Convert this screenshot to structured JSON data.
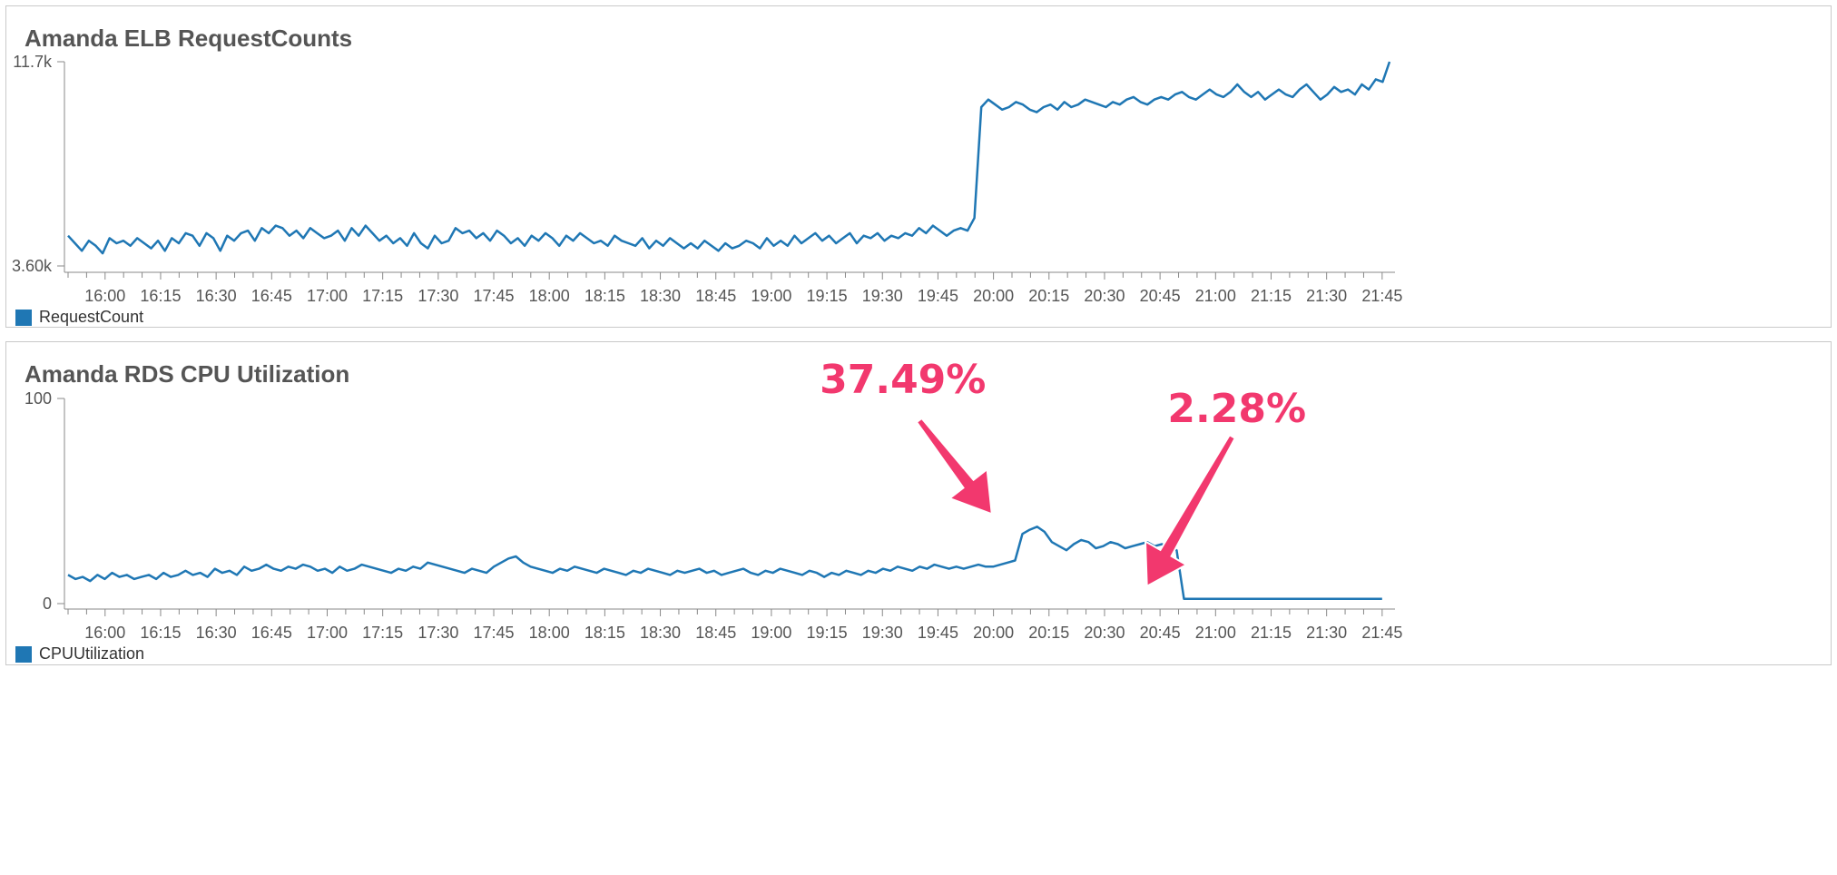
{
  "colors": {
    "series": "#1f77b4",
    "annotation": "#f2386e",
    "axis": "#888888"
  },
  "chart_data": [
    {
      "type": "line",
      "title": "Amanda ELB RequestCounts",
      "ytick_labels": [
        "3.60k",
        "11.7k"
      ],
      "ylim": [
        3600,
        11700
      ],
      "xticks": [
        "16:00",
        "16:15",
        "16:30",
        "16:45",
        "17:00",
        "17:15",
        "17:30",
        "17:45",
        "18:00",
        "18:15",
        "18:30",
        "18:45",
        "19:00",
        "19:15",
        "19:30",
        "19:45",
        "20:00",
        "20:15",
        "20:30",
        "20:45",
        "21:00",
        "21:15",
        "21:30",
        "21:45"
      ],
      "x_range": [
        "15:50",
        "21:47"
      ],
      "legend": "bottom-left",
      "grid": false,
      "series": [
        {
          "name": "RequestCount",
          "x_start": "15:50",
          "x_end": "21:47",
          "values": [
            4800,
            4500,
            4200,
            4600,
            4400,
            4100,
            4700,
            4500,
            4600,
            4400,
            4700,
            4500,
            4300,
            4600,
            4200,
            4700,
            4500,
            4900,
            4800,
            4400,
            4900,
            4700,
            4200,
            4800,
            4600,
            4900,
            5000,
            4600,
            5100,
            4900,
            5200,
            5100,
            4800,
            5000,
            4700,
            5100,
            4900,
            4700,
            4800,
            5000,
            4600,
            5100,
            4800,
            5200,
            4900,
            4600,
            4800,
            4500,
            4700,
            4400,
            4900,
            4500,
            4300,
            4800,
            4500,
            4600,
            5100,
            4900,
            5000,
            4700,
            4900,
            4600,
            5000,
            4800,
            4500,
            4700,
            4400,
            4800,
            4600,
            4900,
            4700,
            4400,
            4800,
            4600,
            4900,
            4700,
            4500,
            4600,
            4400,
            4800,
            4600,
            4500,
            4400,
            4700,
            4300,
            4600,
            4400,
            4700,
            4500,
            4300,
            4500,
            4300,
            4600,
            4400,
            4200,
            4500,
            4300,
            4400,
            4600,
            4500,
            4300,
            4700,
            4400,
            4600,
            4400,
            4800,
            4500,
            4700,
            4900,
            4600,
            4800,
            4500,
            4700,
            4900,
            4500,
            4800,
            4700,
            4900,
            4600,
            4800,
            4700,
            4900,
            4800,
            5100,
            4900,
            5200,
            5000,
            4800,
            5000,
            5100,
            5000,
            5500,
            9900,
            10200,
            10000,
            9800,
            9900,
            10100,
            10000,
            9800,
            9700,
            9900,
            10000,
            9800,
            10100,
            9900,
            10000,
            10200,
            10100,
            10000,
            9900,
            10100,
            10000,
            10200,
            10300,
            10100,
            10000,
            10200,
            10300,
            10200,
            10400,
            10500,
            10300,
            10200,
            10400,
            10600,
            10400,
            10300,
            10500,
            10800,
            10500,
            10300,
            10500,
            10200,
            10400,
            10600,
            10400,
            10300,
            10600,
            10800,
            10500,
            10200,
            10400,
            10700,
            10500,
            10600,
            10400,
            10800,
            10600,
            11000,
            10900,
            11700
          ],
          "annotations": []
        }
      ]
    },
    {
      "type": "line",
      "title": "Amanda RDS CPU Utilization",
      "ytick_labels": [
        "0",
        "100"
      ],
      "ylim": [
        0,
        100
      ],
      "xticks": [
        "16:00",
        "16:15",
        "16:30",
        "16:45",
        "17:00",
        "17:15",
        "17:30",
        "17:45",
        "18:00",
        "18:15",
        "18:30",
        "18:45",
        "19:00",
        "19:15",
        "19:30",
        "19:45",
        "20:00",
        "20:15",
        "20:30",
        "20:45",
        "21:00",
        "21:15",
        "21:30",
        "21:45"
      ],
      "x_range": [
        "15:50",
        "21:47"
      ],
      "legend": "bottom-left",
      "grid": false,
      "series": [
        {
          "name": "CPUUtilization",
          "x_start": "15:50",
          "x_end": "21:45",
          "values": [
            14,
            12,
            13,
            11,
            14,
            12,
            15,
            13,
            14,
            12,
            13,
            14,
            12,
            15,
            13,
            14,
            16,
            14,
            15,
            13,
            17,
            15,
            16,
            14,
            18,
            16,
            17,
            19,
            17,
            16,
            18,
            17,
            19,
            18,
            16,
            17,
            15,
            18,
            16,
            17,
            19,
            18,
            17,
            16,
            15,
            17,
            16,
            18,
            17,
            20,
            19,
            18,
            17,
            16,
            15,
            17,
            16,
            15,
            18,
            20,
            22,
            23,
            20,
            18,
            17,
            16,
            15,
            17,
            16,
            18,
            17,
            16,
            15,
            17,
            16,
            15,
            14,
            16,
            15,
            17,
            16,
            15,
            14,
            16,
            15,
            16,
            17,
            15,
            16,
            14,
            15,
            16,
            17,
            15,
            14,
            16,
            15,
            17,
            16,
            15,
            14,
            16,
            15,
            13,
            15,
            14,
            16,
            15,
            14,
            16,
            15,
            17,
            16,
            18,
            17,
            16,
            18,
            17,
            19,
            18,
            17,
            18,
            17,
            18,
            19,
            18,
            18,
            19,
            20,
            21,
            34,
            36,
            37.49,
            35,
            30,
            28,
            26,
            29,
            31,
            30,
            27,
            28,
            30,
            29,
            27,
            28,
            29,
            30,
            28,
            29,
            27,
            26,
            2.28,
            2.28,
            2.28,
            2.28,
            2.28,
            2.28,
            2.28,
            2.28,
            2.28,
            2.28,
            2.28,
            2.28,
            2.28,
            2.28,
            2.28,
            2.28,
            2.28,
            2.28,
            2.28,
            2.28,
            2.28,
            2.28,
            2.28,
            2.28,
            2.28,
            2.28,
            2.28,
            2.28
          ],
          "annotations": [
            {
              "label": "37.49%",
              "value": 37.49,
              "x": "20:02"
            },
            {
              "label": "2.28%",
              "value": 2.28,
              "x": "20:40"
            }
          ]
        }
      ]
    }
  ]
}
